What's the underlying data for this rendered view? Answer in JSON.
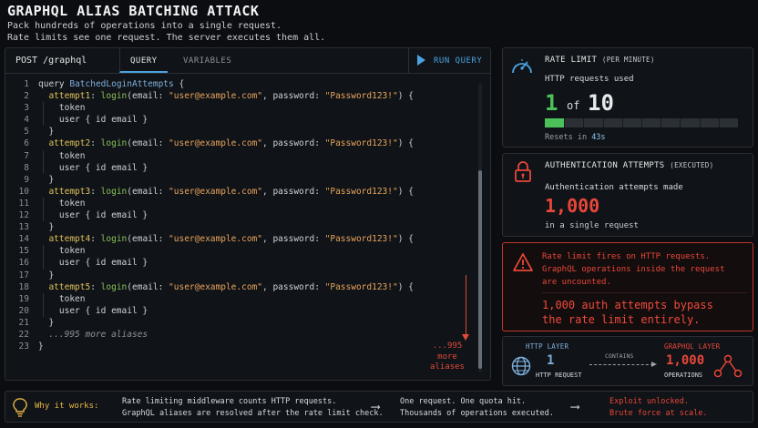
{
  "header": {
    "title": "GRAPHQL ALIAS BATCHING ATTACK",
    "subtitle_line1": "Pack hundreds of operations into a single request.",
    "subtitle_line2": "Rate limits see one request. The server executes them all."
  },
  "editor": {
    "endpoint": "POST /graphql",
    "tabs": [
      "QUERY",
      "VARIABLES"
    ],
    "run_label": "RUN QUERY",
    "operation_keyword": "query",
    "operation_name": "BatchedLoginAttempts",
    "aliases": [
      {
        "alias": "attempt1",
        "email": "\"user@example.com\"",
        "password": "\"Password123!\""
      },
      {
        "alias": "attempt2",
        "email": "\"user@example.com\"",
        "password": "\"Password123!\""
      },
      {
        "alias": "attempt3",
        "email": "\"user@example.com\"",
        "password": "\"Password123!\""
      },
      {
        "alias": "attempt4",
        "email": "\"user@example.com\"",
        "password": "\"Password123!\""
      },
      {
        "alias": "attempt5",
        "email": "\"user@example.com\"",
        "password": "\"Password123!\""
      }
    ],
    "field_call": "login",
    "field_token": "token",
    "field_user": "user { id email }",
    "comment": "...995 more aliases",
    "more_note": [
      "...995",
      "more",
      "aliases"
    ]
  },
  "rate_limit": {
    "title": "RATE LIMIT",
    "title_note": "(PER MINUTE)",
    "label": "HTTP requests used",
    "used": "1",
    "of": "of",
    "limit": "10",
    "progress_fraction": 0.1,
    "reset_prefix": "Resets in",
    "reset_value": "43s"
  },
  "auth_attempts": {
    "title": "AUTHENTICATION ATTEMPTS",
    "title_note": "(EXECUTED)",
    "label": "Authentication attempts made",
    "value": "1,000",
    "footer": "in a single request"
  },
  "alert": {
    "line1": "Rate limit fires on HTTP requests.",
    "line2": "GraphQL operations inside the request",
    "line3": "are uncounted.",
    "big1": "1,000 auth attempts bypass",
    "big2": "the rate limit entirely."
  },
  "layers": {
    "http_label": "HTTP LAYER",
    "http_value": "1",
    "http_caption": "HTTP REQUEST",
    "contains": "CONTAINS",
    "gql_label": "GRAPHQL LAYER",
    "gql_value": "1,000",
    "gql_caption": "OPERATIONS"
  },
  "footer": {
    "why": "Why it works:",
    "col1_line1": "Rate limiting middleware counts HTTP requests.",
    "col1_line2": "GraphQL aliases are resolved after the rate limit check.",
    "col2_line1": "One request. One quota hit.",
    "col2_line2": "Thousands of operations executed.",
    "col3_line1": "Exploit unlocked.",
    "col3_line2": "Brute force at scale."
  },
  "colors": {
    "accent_blue": "#4aa3df",
    "success_green": "#4cc15a",
    "danger_red": "#e8473a",
    "warning_yellow": "#e8b847"
  },
  "icons": [
    "gauge-icon",
    "lock-icon",
    "warning-triangle-icon",
    "globe-icon",
    "graph-nodes-icon",
    "lightbulb-icon",
    "play-icon"
  ]
}
